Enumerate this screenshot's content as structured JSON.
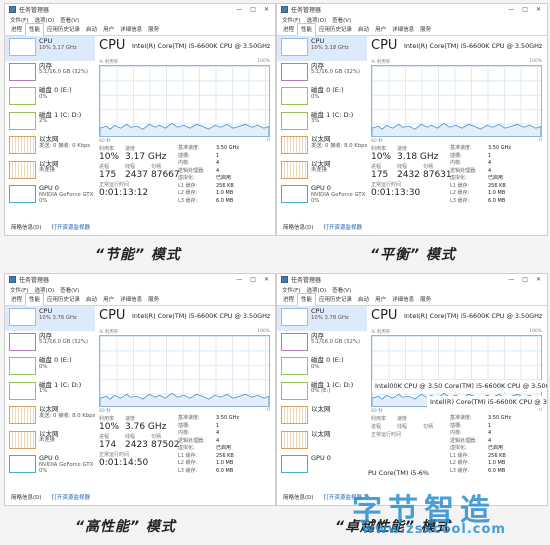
{
  "common": {
    "app_title": "任务管理器",
    "window_controls": [
      "—",
      "□",
      "✕"
    ],
    "menu": [
      "文件(F)",
      "选项(O)",
      "查看(V)"
    ],
    "tabs": [
      "进程",
      "性能",
      "应用历史记录",
      "启动",
      "用户",
      "详细信息",
      "服务"
    ],
    "active_tab_index": 1,
    "cpu_title": "CPU",
    "cpu_model": "Intel(R) Core(TM) i5-6600K CPU @ 3.50GHz",
    "graph_label_left": "% 利用率",
    "graph_label_right": "100%",
    "graph_foot_left": "60 秒",
    "graph_foot_right": "0",
    "stat_labels": {
      "util": "利用率",
      "speed": "速度",
      "proc": "进程",
      "threads": "线程",
      "handles": "句柄",
      "uptime": "正常运行时间"
    },
    "prop_labels": [
      "基准速度:",
      "插槽:",
      "内核:",
      "逻辑处理器:",
      "虚拟化:",
      "L1 缓存:",
      "L2 缓存:",
      "L3 缓存:"
    ],
    "prop_values": [
      "3.50 GHz",
      "1",
      "4",
      "4",
      "已启用",
      "256 KB",
      "1.0 MB",
      "6.0 MB"
    ],
    "bottom_less": "简略信息(D)",
    "bottom_link": "打开资源监视器",
    "sidebar_names": [
      "CPU",
      "内存",
      "磁盘 0 (E:)",
      "磁盘 1 (C: D:)",
      "以太网",
      "以太网",
      "GPU 0"
    ],
    "accent": "#1a73c8"
  },
  "panels": [
    {
      "caption": "“节能” 模式",
      "sidebar_details": [
        "10% 3.17 GHz",
        "5.1/16.0 GB (32%)",
        "0%",
        "2%",
        "发送: 0 接收: 0 Kbps",
        "未连接",
        "NVIDIA GeForce GTX\n0%"
      ],
      "util": "10%",
      "speed": "3.17 GHz",
      "proc": "175",
      "threads": "2437",
      "handles": "87667",
      "uptime": "0:01:13:12"
    },
    {
      "caption": "“平衡” 模式",
      "sidebar_details": [
        "10% 3.18 GHz",
        "5.1/16.0 GB (32%)",
        "0%",
        "3%",
        "发送: 0 接收: 8.0 Kbps",
        "未连接",
        "NVIDIA GeForce GTX\n0%"
      ],
      "util": "10%",
      "speed": "3.18 GHz",
      "proc": "175",
      "threads": "2432",
      "handles": "87631",
      "uptime": "0:01:13:30"
    },
    {
      "caption": "“高性能” 模式",
      "sidebar_details": [
        "10% 3.76 GHz",
        "5.1/16.0 GB (32%)",
        "0%",
        "1%",
        "发送: 0 接收: 8.0 Kbps",
        "未连接",
        "NVIDIA GeForce GTX\n0%"
      ],
      "util": "10%",
      "speed": "3.76 GHz",
      "proc": "174",
      "threads": "2423",
      "handles": "87502",
      "uptime": "0:01:14:50"
    },
    {
      "caption": "“卓越性能” 模式",
      "sidebar_details": [
        "10% 3.78 GHz",
        "5.1/16.0 GB (32%)",
        "0%",
        "0% (E:)",
        "",
        "",
        ""
      ],
      "overlays": [
        "Intel00K CPU @ 3.50 Core(TM) i5-6600K CPU @ 3.50GHz",
        "Intel(R) Core(TM) i5-6600K CPU @ 3.50GHz",
        "PU Core(TM) i5-6%"
      ]
    }
  ],
  "watermark": {
    "main": "字节智造",
    "url": "www.zsxcool.com"
  }
}
